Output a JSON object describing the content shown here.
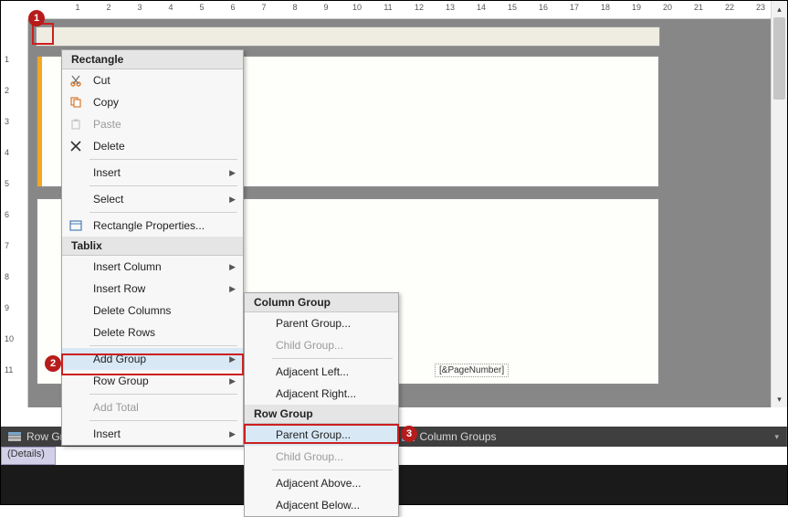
{
  "ruler_h": [
    1,
    2,
    3,
    4,
    5,
    6,
    7,
    8,
    9,
    10,
    11,
    12,
    13,
    14,
    15,
    16,
    17,
    18,
    19,
    20,
    21,
    22,
    23
  ],
  "ruler_v": [
    1,
    2,
    3,
    4,
    5,
    6,
    7,
    8,
    9,
    10,
    11
  ],
  "pagenum_expr": "[&PageNumber]",
  "groups": {
    "row": "Row Groups",
    "col": "Column Groups"
  },
  "details": "(Details)",
  "menu1": {
    "hdr1": "Rectangle",
    "cut": "Cut",
    "copy": "Copy",
    "paste": "Paste",
    "delete": "Delete",
    "insert1": "Insert",
    "select": "Select",
    "props": "Rectangle Properties...",
    "hdr2": "Tablix",
    "insert_col": "Insert Column",
    "insert_row": "Insert Row",
    "del_cols": "Delete Columns",
    "del_rows": "Delete Rows",
    "add_group": "Add Group",
    "row_group": "Row Group",
    "add_total": "Add Total",
    "insert2": "Insert"
  },
  "menu2": {
    "hdr1": "Column Group",
    "parent_c": "Parent Group...",
    "child_c": "Child Group...",
    "adj_left": "Adjacent Left...",
    "adj_right": "Adjacent Right...",
    "hdr2": "Row Group",
    "parent_r": "Parent Group...",
    "child_r": "Child Group...",
    "adj_above": "Adjacent Above...",
    "adj_below": "Adjacent Below..."
  },
  "badges": {
    "b1": "1",
    "b2": "2",
    "b3": "3"
  }
}
